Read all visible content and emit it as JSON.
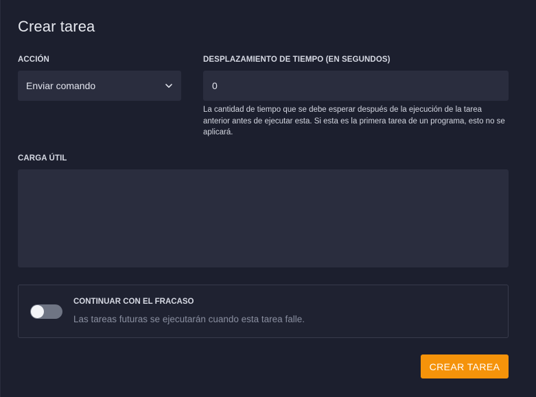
{
  "modal": {
    "title": "Crear tarea"
  },
  "action": {
    "label": "ACCIÓN",
    "selected": "Enviar comando",
    "icon": "chevron-down-icon"
  },
  "time_offset": {
    "label": "DESPLAZAMIENTO DE TIEMPO (EN SEGUNDOS)",
    "value": "0",
    "helper": "La cantidad de tiempo que se debe esperar después de la ejecución de la tarea anterior antes de ejecutar esta. Si esta es la primera tarea de un programa, esto no se aplicará."
  },
  "payload": {
    "label": "CARGA ÚTIL",
    "value": ""
  },
  "continue_on_failure": {
    "label": "CONTINUAR CON EL FRACASO",
    "description": "Las tareas futuras se ejecutarán cuando esta tarea falle.",
    "enabled": false
  },
  "submit": {
    "label": "CREAR TAREA"
  },
  "colors": {
    "background": "#1c1f2e",
    "field": "#2a2d3e",
    "accent": "#f5930a",
    "toggle_off": "#6f7584"
  }
}
